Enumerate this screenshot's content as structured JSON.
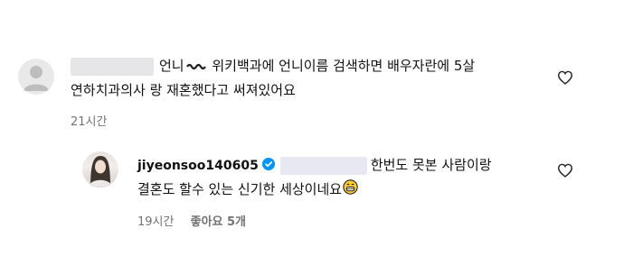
{
  "comment1": {
    "text_line1": "언니",
    "text_line1_rest": " 위키백과에 언니이름 검색하면 배우자란에 5살",
    "text_line2": "연하치과의사 랑 재혼했다고 써져있어요",
    "time": "21시간",
    "icons": {
      "avatar": "default-avatar-icon",
      "wave": "wave-emoji-icon",
      "like": "heart-outline-icon"
    }
  },
  "comment2": {
    "username": "jiyeonsoo140605",
    "text_line1": "한번도 못본 사람이랑",
    "text_line2": "결혼도 할수 있는 신기한 세상이네요",
    "time": "19시간",
    "likes": "좋아요 5개",
    "icons": {
      "verified": "verified-badge-icon",
      "emoji": "grinning-emoji-icon",
      "like": "heart-outline-icon"
    }
  },
  "colors": {
    "meta": "#737373",
    "verified": "#0095f6",
    "redacted": "#e6e6e8"
  }
}
